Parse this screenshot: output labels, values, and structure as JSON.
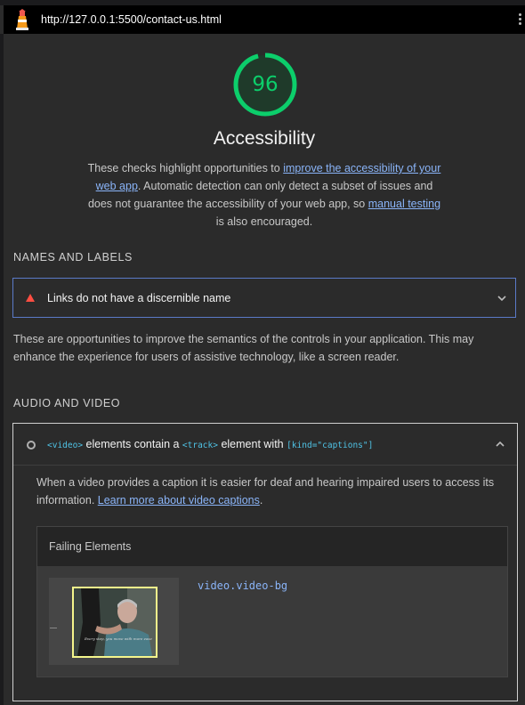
{
  "browser": {
    "url": "http://127.0.0.1:5500/contact-us.html",
    "logo_icon": "lighthouse-icon",
    "menu_icon": "kebab-menu-icon"
  },
  "category": {
    "score": "96",
    "score_color": "#0cce6b",
    "title": "Accessibility",
    "desc_1": "These checks highlight opportunities to ",
    "desc_link_1": "improve the accessibility of your web app",
    "desc_2": ". Automatic detection can only detect a subset of issues and does not guarantee the accessibility of your web app, so ",
    "desc_link_2": "manual testing",
    "desc_3": " is also encouraged."
  },
  "groups": [
    {
      "title": "NAMES AND LABELS",
      "audit_title": "Links do not have a discernible name",
      "status_icon": "fail-triangle-icon",
      "status_color": "#ff4e42",
      "description": "These are opportunities to improve the semantics of the controls in your application. This may enhance the experience for users of assistive technology, like a screen reader."
    },
    {
      "title": "AUDIO AND VIDEO",
      "audit_title": {
        "code_1": "<video>",
        "text_1": " elements contain a ",
        "code_2": "<track>",
        "text_2": " element with ",
        "code_3": "[kind=\"captions\"]"
      },
      "status_icon": "circle-icon",
      "description_1": "When a video provides a caption it is easier for deaf and hearing impaired users to access its information. ",
      "description_link": "Learn more about video captions",
      "description_2": ".",
      "failing": {
        "header": "Failing Elements",
        "node_label": "video.video-bg",
        "thumbnail_caption": "Every step, you move with more ease"
      }
    }
  ]
}
